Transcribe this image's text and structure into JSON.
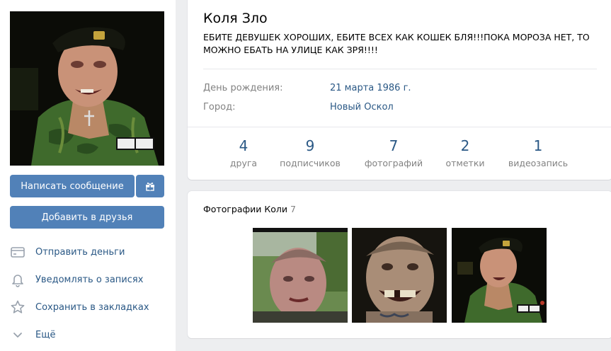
{
  "profile": {
    "name": "Коля Зло",
    "status": "ЕБИТЕ ДЕВУШЕК ХОРОШИХ, ЕБИТЕ ВСЕХ КАК КОШЕК БЛЯ!!!ПОКА МОРОЗА НЕТ, ТО МОЖНО ЕБАТЬ НА УЛИЦЕ КАК ЗРЯ!!!!"
  },
  "info": {
    "birthday_label": "День рождения:",
    "birthday_value": "21 марта 1986 г.",
    "city_label": "Город:",
    "city_value": "Новый Оскол"
  },
  "counters": [
    {
      "num": "4",
      "caption": "друга"
    },
    {
      "num": "9",
      "caption": "подписчиков"
    },
    {
      "num": "7",
      "caption": "фотографий"
    },
    {
      "num": "2",
      "caption": "отметки"
    },
    {
      "num": "1",
      "caption": "видеозапись"
    }
  ],
  "actions": {
    "message_label": "Написать сообщение",
    "add_friend_label": "Добавить в друзья",
    "gift_icon": "gift-icon"
  },
  "menu": [
    {
      "icon": "card-icon",
      "label": "Отправить деньги"
    },
    {
      "icon": "bell-icon",
      "label": "Уведомлять о записях"
    },
    {
      "icon": "star-icon",
      "label": "Сохранить в закладках"
    },
    {
      "icon": "chevron-down-icon",
      "label": "Ещё"
    }
  ],
  "photos": {
    "title": "Фотографии Коли",
    "count": "7"
  },
  "colors": {
    "accent": "#5181b8",
    "link": "#2a5885",
    "muted": "#828282",
    "background": "#edeef0"
  }
}
